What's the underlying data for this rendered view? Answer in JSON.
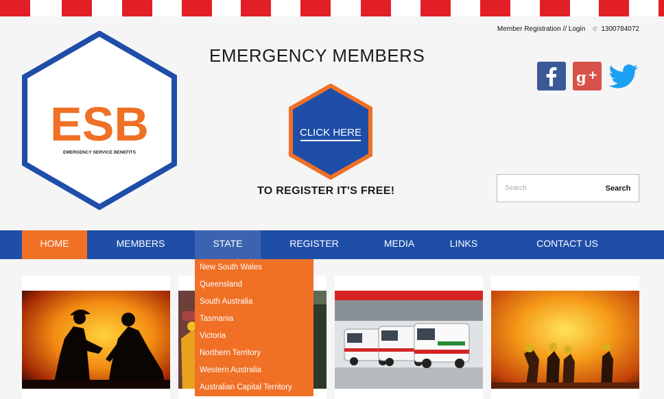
{
  "topbar": {
    "member_link": "Member Registration // Login",
    "phone": "1300784072"
  },
  "logo": {
    "acronym": "ESB",
    "tagline": "EMERGENCY SERVICE BENEFITS"
  },
  "hero": {
    "headline": "EMERGENCY MEMBERS",
    "cta_label": "CLICK HERE",
    "subtext": "TO REGISTER IT'S FREE!"
  },
  "social": {
    "icons": [
      "facebook-icon",
      "google-plus-icon",
      "twitter-icon"
    ]
  },
  "search": {
    "placeholder": "Search",
    "button": "Search"
  },
  "nav": {
    "items": [
      {
        "label": "HOME"
      },
      {
        "label": "MEMBERS"
      },
      {
        "label": "STATE"
      },
      {
        "label": "REGISTER"
      },
      {
        "label": "MEDIA"
      },
      {
        "label": "LINKS"
      },
      {
        "label": "CONTACT US"
      }
    ],
    "active": "HOME",
    "open_menu": "STATE"
  },
  "state_menu": [
    "New South Wales",
    "Queensland",
    "South Australia",
    "Tasmania",
    "Victoria",
    "Northern Territory",
    "Western Australia",
    "Australian Capital Territory"
  ],
  "cards": [
    "firefighters-silhouette-photo",
    "emergency-responder-photo",
    "ambulances-photo",
    "firefighting-hoses-photo"
  ],
  "colors": {
    "brand_blue": "#1e4ea8",
    "brand_orange": "#f07026",
    "stripe_red": "#e21f26"
  }
}
